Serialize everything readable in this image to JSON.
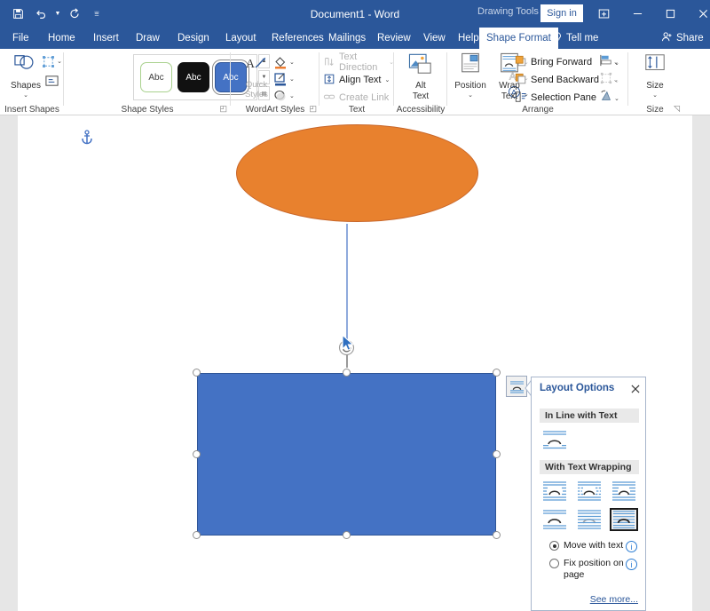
{
  "titlebar": {
    "document_title": "Document1  -  Word",
    "contextual_tab_label": "Drawing Tools",
    "signin_label": "Sign in",
    "qat": [
      {
        "name": "save-icon",
        "label": "Save"
      },
      {
        "name": "undo-icon",
        "label": "Undo"
      },
      {
        "name": "redo-icon",
        "label": "Redo"
      },
      {
        "name": "customize-qat-icon",
        "label": "Customize Quick Access Toolbar"
      }
    ],
    "ribbon_display_options": "Ribbon Display Options",
    "minimize": "Minimize",
    "maximize": "Maximize",
    "close": "Close"
  },
  "tabs": [
    {
      "label": "File",
      "active": false
    },
    {
      "label": "Home",
      "active": false
    },
    {
      "label": "Insert",
      "active": false
    },
    {
      "label": "Draw",
      "active": false
    },
    {
      "label": "Design",
      "active": false
    },
    {
      "label": "Layout",
      "active": false
    },
    {
      "label": "References",
      "active": false
    },
    {
      "label": "Mailings",
      "active": false
    },
    {
      "label": "Review",
      "active": false
    },
    {
      "label": "View",
      "active": false
    },
    {
      "label": "Help",
      "active": false
    },
    {
      "label": "Shape Format",
      "active": true
    }
  ],
  "tell_me": "Tell me",
  "share": "Share",
  "ribbon": {
    "groups": [
      {
        "label": "Insert Shapes"
      },
      {
        "label": "Shape Styles"
      },
      {
        "label": "WordArt Styles"
      },
      {
        "label": "Text"
      },
      {
        "label": "Accessibility"
      },
      {
        "label": "Arrange"
      },
      {
        "label": "Size"
      }
    ],
    "insert_shapes": {
      "shapes_label": "Shapes",
      "edit_shape_label": "Edit Shape",
      "text_box_label": "Draw Text Box"
    },
    "shape_styles": {
      "thumbnails": [
        {
          "text": "Abc",
          "style": "white"
        },
        {
          "text": "Abc",
          "style": "black"
        },
        {
          "text": "Abc",
          "style": "blue",
          "selected": true
        }
      ],
      "shape_fill": "Shape Fill",
      "shape_outline": "Shape Outline",
      "shape_effects": "Shape Effects"
    },
    "wordart_styles": {
      "quick_styles_line1": "Quick",
      "quick_styles_line2": "Styles",
      "text_fill": "Text Fill",
      "text_outline": "Text Outline",
      "text_effects": "Text Effects"
    },
    "text": {
      "text_direction": "Text Direction",
      "align_text": "Align Text",
      "create_link": "Create Link"
    },
    "accessibility": {
      "alt_text_line1": "Alt",
      "alt_text_line2": "Text"
    },
    "arrange": {
      "position": "Position",
      "wrap_text_line1": "Wrap",
      "wrap_text_line2": "Text",
      "bring_forward": "Bring Forward",
      "send_backward": "Send Backward",
      "selection_pane": "Selection Pane",
      "align_objects": "Align Objects",
      "group_objects": "Group Objects",
      "rotate_objects": "Rotate Objects"
    },
    "size": {
      "label": "Size"
    }
  },
  "document": {
    "anchor_icon": "anchor-icon",
    "shapes": [
      {
        "name": "ellipse-shape",
        "type": "ellipse",
        "fill": "#e8812e",
        "stroke": "#c9672a"
      },
      {
        "name": "rectangle-shape",
        "type": "rectangle",
        "fill": "#4472c4",
        "stroke": "#2f5597",
        "selected": true
      },
      {
        "name": "connector-line",
        "type": "line",
        "stroke": "#8faadc"
      }
    ]
  },
  "layout_options": {
    "launcher_icon": "layout-options-icon",
    "title": "Layout Options",
    "close_label": "Close",
    "section_inline": "In Line with Text",
    "section_wrapping": "With Text Wrapping",
    "inline_options": [
      {
        "name": "in-line-with-text",
        "selected": false
      }
    ],
    "wrapping_options": [
      {
        "name": "square-wrap",
        "selected": false
      },
      {
        "name": "tight-wrap",
        "selected": false
      },
      {
        "name": "through-wrap",
        "selected": false
      },
      {
        "name": "top-and-bottom-wrap",
        "selected": false
      },
      {
        "name": "behind-text-wrap",
        "selected": false
      },
      {
        "name": "in-front-of-text-wrap",
        "selected": true
      }
    ],
    "move_with_text": "Move with text",
    "fix_position_line1": "Fix position on",
    "fix_position_line2": "page",
    "move_with_text_selected": true,
    "fix_position_selected": false,
    "info_label": "More information",
    "see_more": "See more..."
  },
  "colors": {
    "word_blue": "#2b579a",
    "shape_blue": "#4472c4",
    "shape_orange": "#e8812e",
    "accent_link": "#2b579a"
  }
}
